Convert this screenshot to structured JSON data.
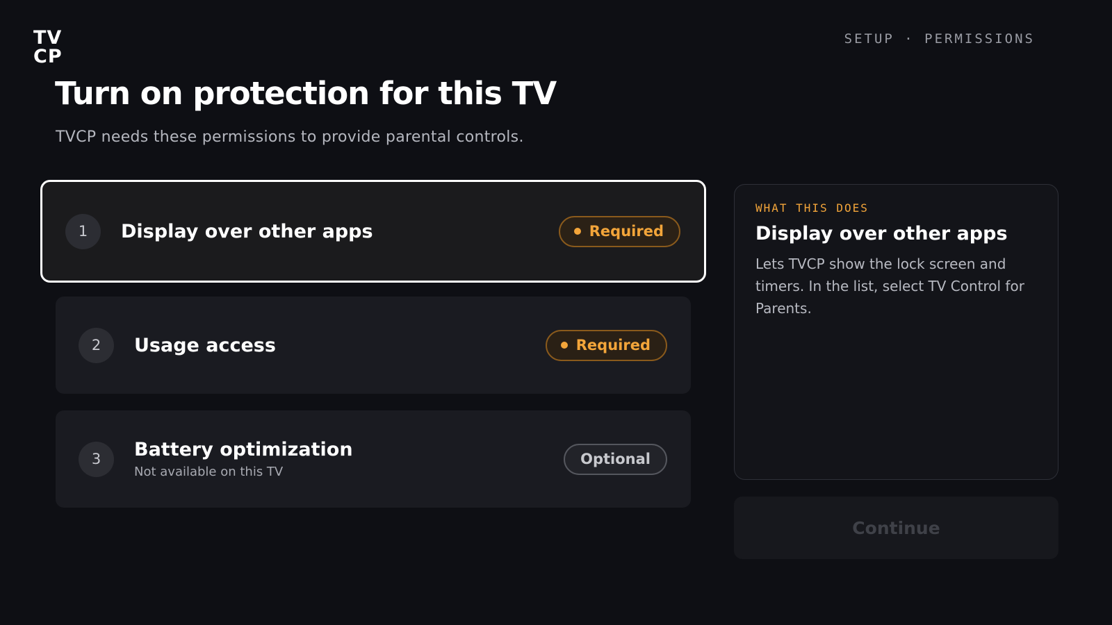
{
  "brand": {
    "logo_line1": "TV",
    "logo_line2": "CP"
  },
  "header": {
    "step_indicator": "SETUP · PERMISSIONS"
  },
  "page": {
    "title": "Turn on protection for this TV",
    "subtitle": "TVCP needs these permissions to provide parental controls."
  },
  "permissions": [
    {
      "number": "1",
      "title": "Display over other apps",
      "subtitle": "",
      "badge": "Required",
      "focused": true
    },
    {
      "number": "2",
      "title": "Usage access",
      "subtitle": "",
      "badge": "Required",
      "focused": false
    },
    {
      "number": "3",
      "title": "Battery optimization",
      "subtitle": "Not available on this TV",
      "badge": "Optional",
      "focused": false
    }
  ],
  "info_panel": {
    "kicker": "WHAT THIS DOES",
    "title": "Display over other apps",
    "body": "Lets TVCP show the lock screen and timers. In the list, select TV Control for Parents."
  },
  "actions": {
    "continue_label": "Continue",
    "continue_enabled": false
  },
  "colors": {
    "background": "#0e0f14",
    "accent_required": "#f3a53a",
    "focus_border": "#ffffff"
  }
}
